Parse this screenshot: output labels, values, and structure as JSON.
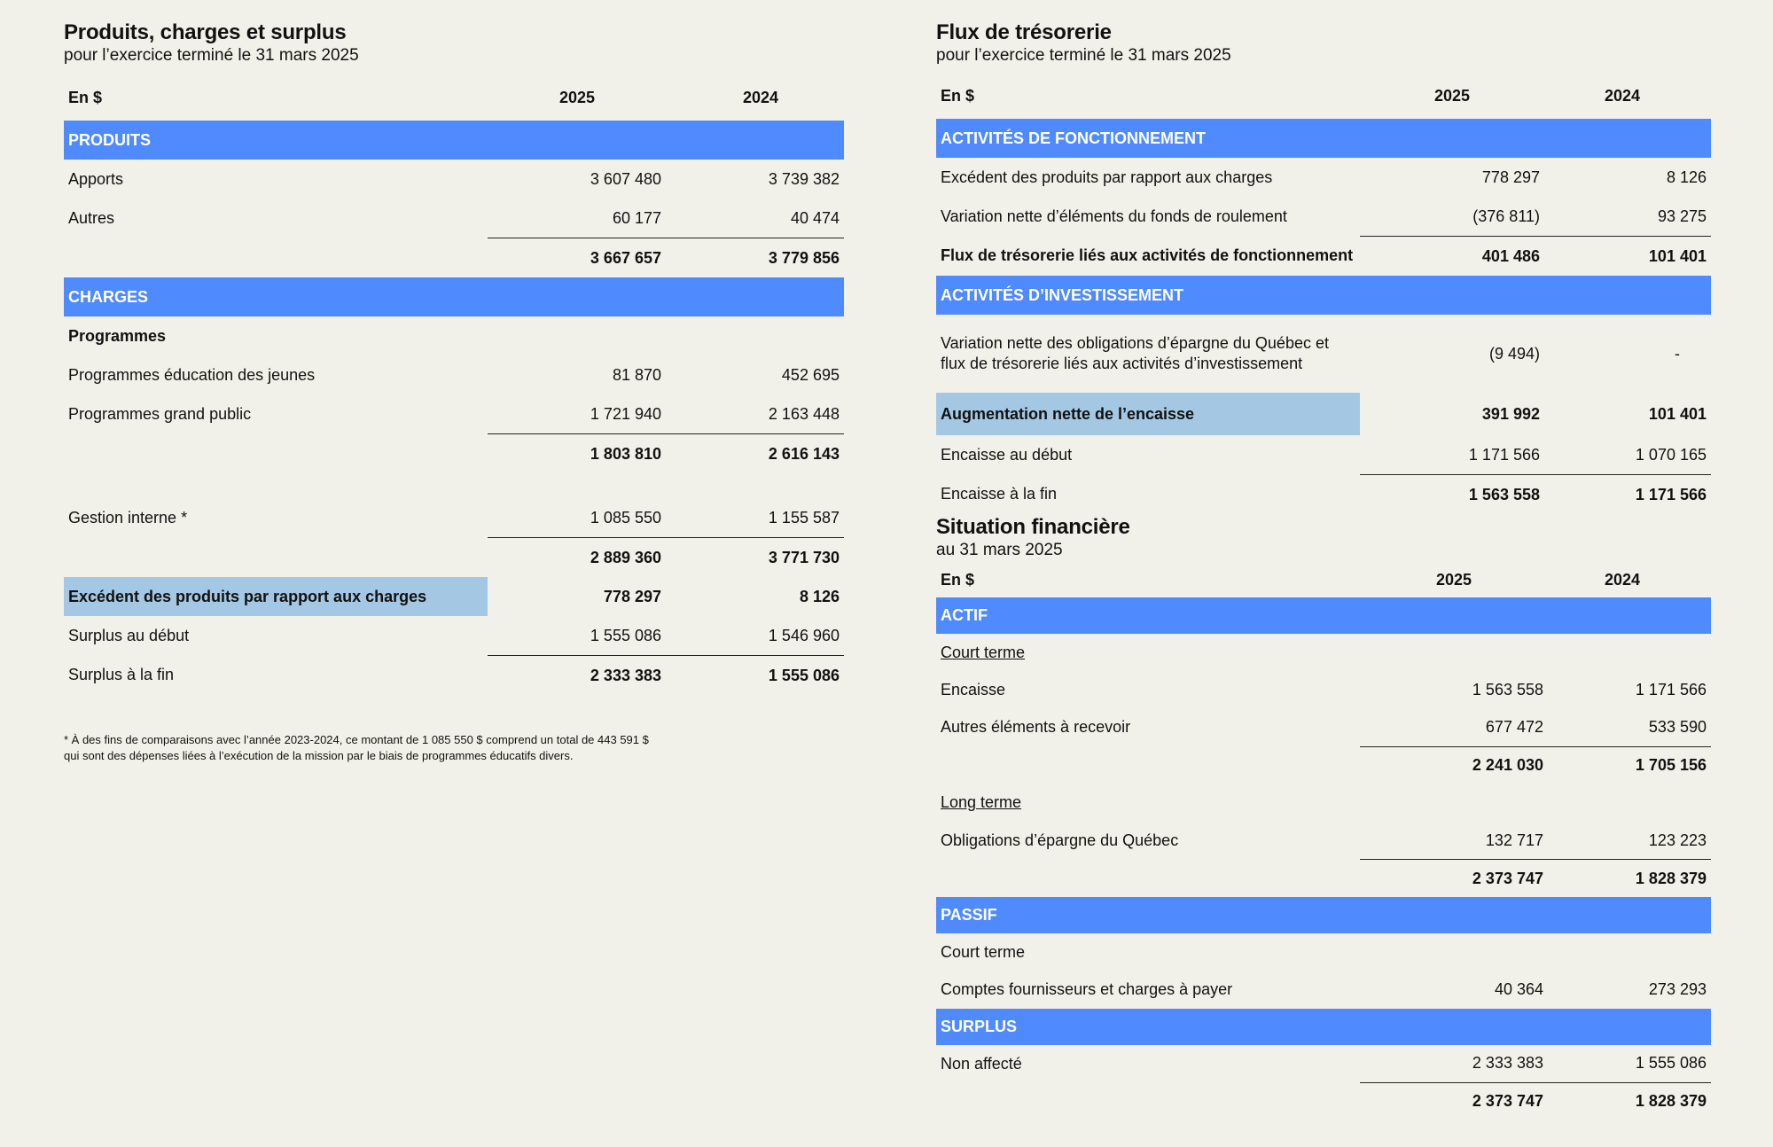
{
  "left": {
    "title": "Produits, charges et surplus",
    "subtitle": "pour l’exercice terminé le 31 mars 2025",
    "col_label": "En $",
    "col_2025": "2025",
    "col_2024": "2024",
    "produits_header": "PRODUITS",
    "apports": {
      "label": "Apports",
      "v2025": "3 607 480",
      "v2024": "3 739 382"
    },
    "autres": {
      "label": "Autres",
      "v2025": "60 177",
      "v2024": "40 474"
    },
    "total_produits": {
      "v2025": "3 667 657",
      "v2024": "3 779 856"
    },
    "charges_header": "CHARGES",
    "programmes_label": "Programmes",
    "prog_jeunes": {
      "label": "Programmes éducation des jeunes",
      "v2025": "81 870",
      "v2024": "452 695"
    },
    "prog_public": {
      "label": "Programmes grand public",
      "v2025": "1 721 940",
      "v2024": "2 163 448"
    },
    "total_programmes": {
      "v2025": "1 803 810",
      "v2024": "2 616 143"
    },
    "gestion": {
      "label": "Gestion interne *",
      "v2025": "1 085 550",
      "v2024": "1 155 587"
    },
    "total_charges": {
      "v2025": "2 889 360",
      "v2024": "3 771 730"
    },
    "excedent": {
      "label": "Excédent des produits par rapport aux charges",
      "v2025": "778 297",
      "v2024": "8 126"
    },
    "surplus_debut": {
      "label": "Surplus au début",
      "v2025": "1 555 086",
      "v2024": "1 546 960"
    },
    "surplus_fin": {
      "label": "Surplus à la fin",
      "v2025": "2 333 383",
      "v2024": "1 555 086"
    },
    "footnote_line1": "* À des fins de comparaisons avec l’année 2023-2024, ce montant de 1 085 550 $ comprend un total de 443 591 $",
    "footnote_line2": "qui sont des dépenses liées à l’exécution de la mission par le biais de programmes éducatifs divers."
  },
  "cash": {
    "title": "Flux de trésorerie",
    "subtitle": "pour l’exercice terminé le 31 mars 2025",
    "col_label": "En $",
    "col_2025": "2025",
    "col_2024": "2024",
    "fonct_header": "ACTIVITÉS DE FONCTIONNEMENT",
    "excedent": {
      "label": "Excédent des produits par rapport aux charges",
      "v2025": "778 297",
      "v2024": "8 126"
    },
    "variation_fonds": {
      "label": "Variation nette d’éléments du fonds de roulement",
      "v2025": "(376 811)",
      "v2024": "93 275"
    },
    "flux_fonct": {
      "label": "Flux de trésorerie liés aux activités de fonctionnement",
      "v2025": "401 486",
      "v2024": "101 401"
    },
    "invest_header": "ACTIVITÉS D’INVESTISSEMENT",
    "variation_oblig": {
      "label_line1": "Variation nette des obligations d’épargne du Québec et",
      "label_line2": "flux de trésorerie liés aux activités d’investissement",
      "v2025": "(9 494)",
      "v2024": "-"
    },
    "augmentation": {
      "label": "Augmentation nette de l’encaisse",
      "v2025": "391 992",
      "v2024": "101 401"
    },
    "encaisse_debut": {
      "label": "Encaisse au début",
      "v2025": "1 171 566",
      "v2024": "1 070 165"
    },
    "encaisse_fin": {
      "label": "Encaisse à la fin",
      "v2025": "1 563 558",
      "v2024": "1 171 566"
    }
  },
  "position": {
    "title": "Situation financière",
    "subtitle": "au 31 mars 2025",
    "col_label": "En $",
    "col_2025": "2025",
    "col_2024": "2024",
    "actif_header": "ACTIF",
    "court_terme_label": "Court terme",
    "encaisse": {
      "label": "Encaisse",
      "v2025": "1 563 558",
      "v2024": "1 171 566"
    },
    "autres_recevoir": {
      "label": "Autres éléments  à recevoir",
      "v2025": "677 472",
      "v2024": "533 590"
    },
    "total_court": {
      "v2025": "2 241 030",
      "v2024": "1 705 156"
    },
    "long_terme_label": "Long terme",
    "obligations": {
      "label": "Obligations d’épargne du Québec",
      "v2025": "132 717",
      "v2024": "123 223"
    },
    "total_actif": {
      "v2025": "2 373 747",
      "v2024": "1 828 379"
    },
    "passif_header": "PASSIF",
    "passif_court_label": "Court terme",
    "fournisseurs": {
      "label": "Comptes fournisseurs et charges à payer",
      "v2025": "40 364",
      "v2024": "273 293"
    },
    "surplus_header": "SURPLUS",
    "non_affecte": {
      "label": "Non affecté",
      "v2025": "2 333 383",
      "v2024": "1 555 086"
    },
    "total_passif": {
      "v2025": "2 373 747",
      "v2024": "1 828 379"
    }
  },
  "colors": {
    "section_blue": "#4f8bff",
    "highlight_blue": "#a4c8e4",
    "background": "#f2f1e9"
  }
}
